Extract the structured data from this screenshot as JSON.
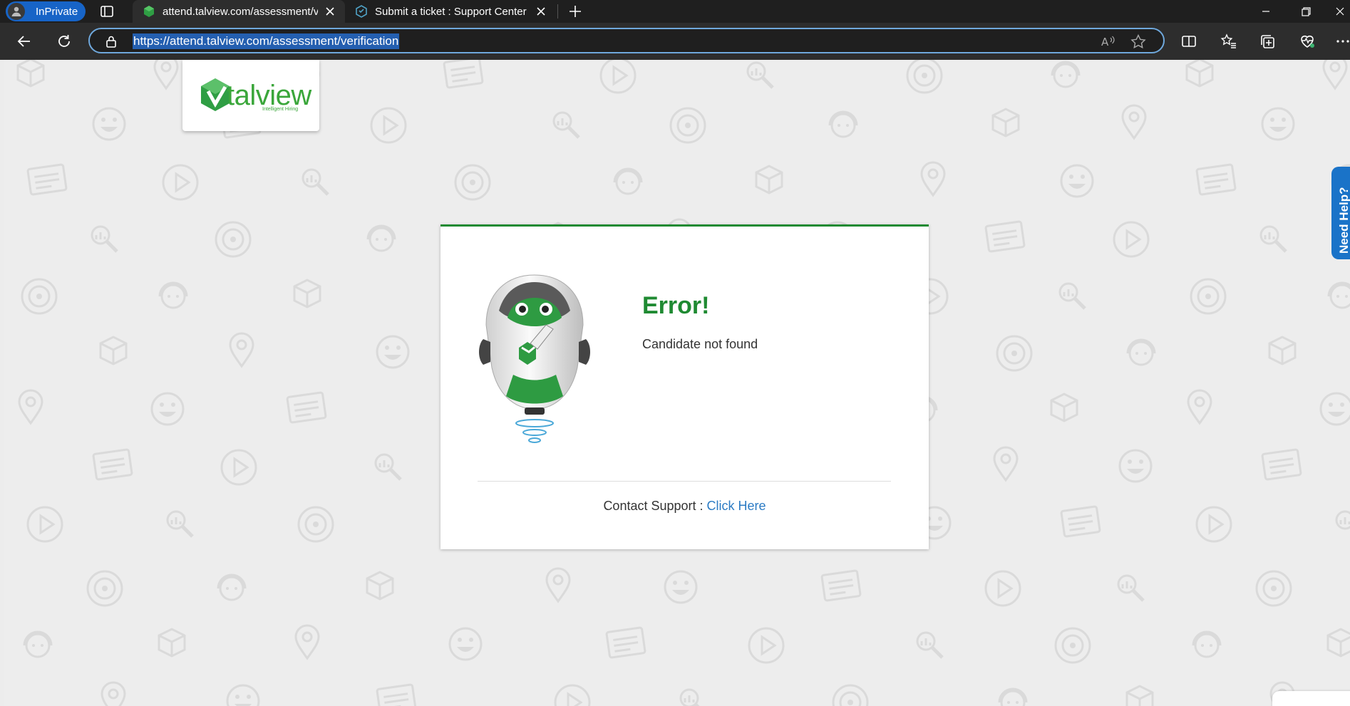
{
  "browser": {
    "profile": {
      "label": "InPrivate"
    },
    "tabs": [
      {
        "title": "attend.talview.com/assessment/v",
        "active": true
      },
      {
        "title": "Submit a ticket : Support Center",
        "active": false
      }
    ],
    "address_bar": {
      "url": "https://attend.talview.com/assessment/verification"
    },
    "colors": {
      "profile_pill": "#1764c7",
      "url_highlight": "#245fb0",
      "address_outline": "#6fa8dc"
    }
  },
  "page": {
    "logo": {
      "text": "talview",
      "tagline": "Intelligent Hiring"
    },
    "error": {
      "title": "Error!",
      "message": "Candidate not found",
      "contact_prefix": "Contact Support : ",
      "contact_link": "Click Here"
    },
    "need_help_tab": {
      "label": "Need Help?"
    },
    "colors": {
      "brand_green": "#1f8a32",
      "link_blue": "#2b7bc4",
      "help_tab": "#1a73c8"
    }
  }
}
